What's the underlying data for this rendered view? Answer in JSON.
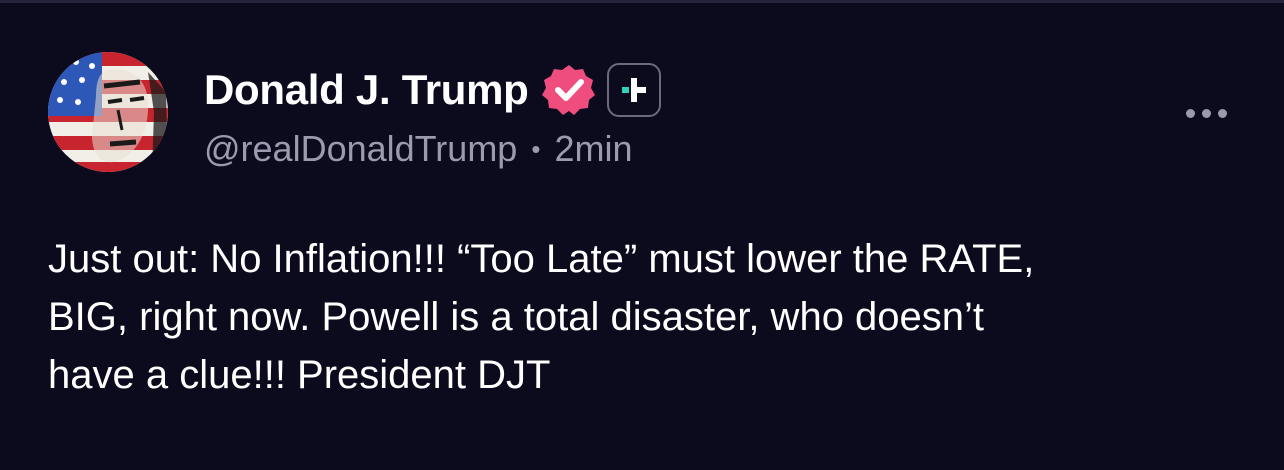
{
  "post": {
    "author": {
      "display_name": "Donald J. Trump",
      "handle": "@realDonaldTrump",
      "timestamp": "2min",
      "separator": "•",
      "avatar_icon": "flag-face-avatar",
      "verified_icon": "verified-badge-icon",
      "follow_icon": "plus-icon"
    },
    "body_lines": [
      "Just out: No Inflation!!! “Too Late” must lower the RATE,",
      "BIG, right now. Powell is a total disaster, who doesn’t",
      "have a clue!!! President DJT"
    ],
    "more_icon": "more-options-icon"
  },
  "colors": {
    "background": "#0c0a1d",
    "text_primary": "#ffffff",
    "text_secondary": "#9b9aae",
    "verified": "#f04d7f",
    "accent": "#2fd1b8"
  }
}
